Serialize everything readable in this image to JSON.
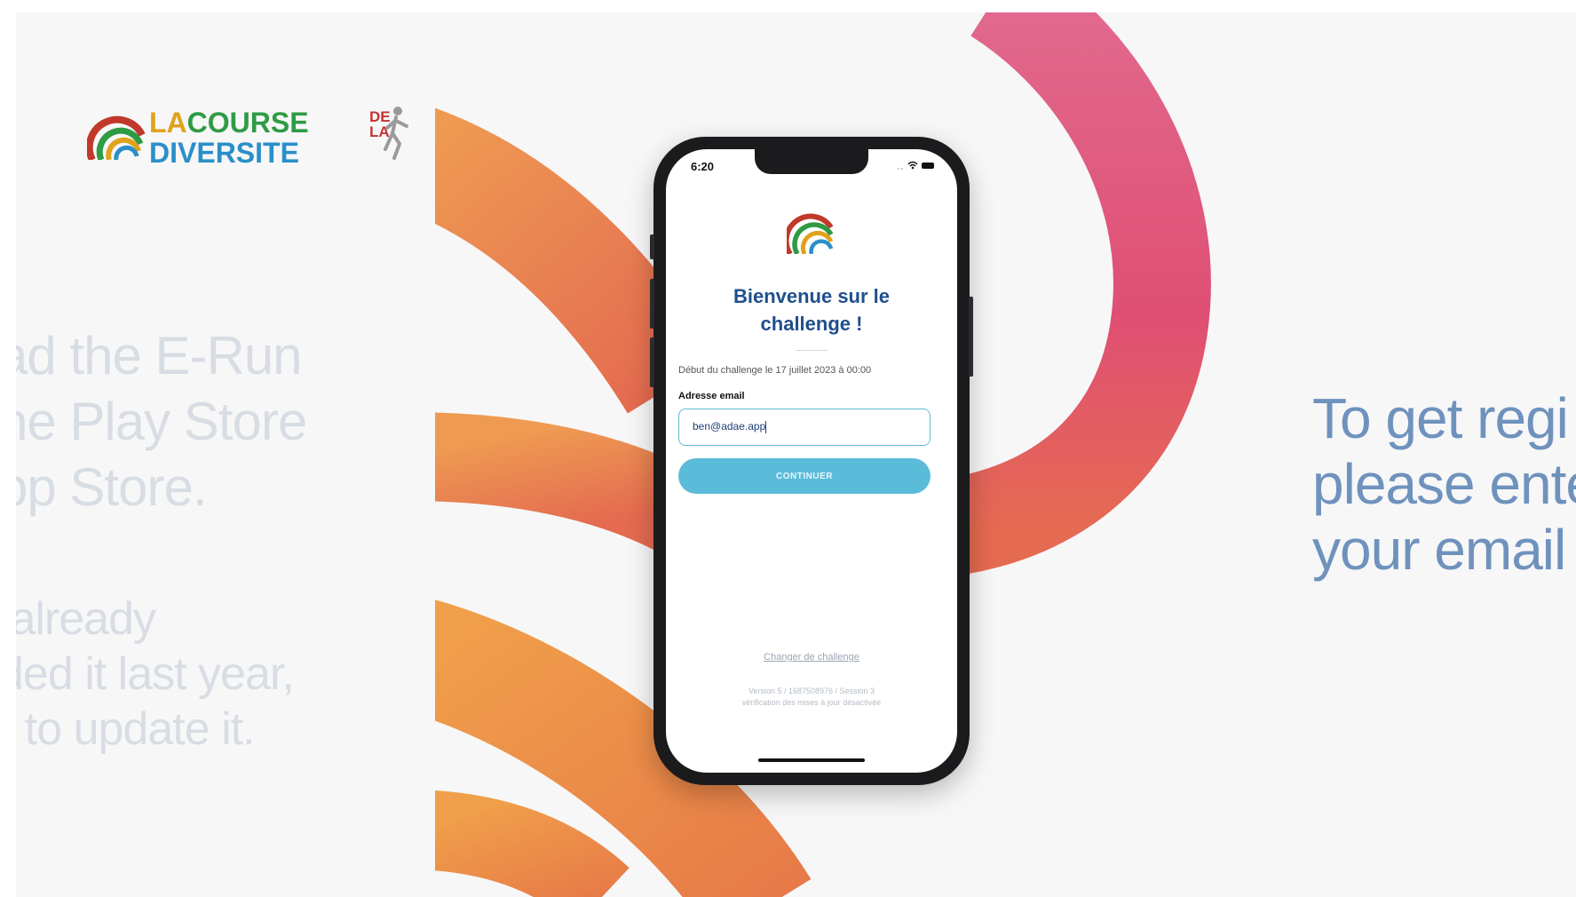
{
  "logo": {
    "line1_la": "LA",
    "line1_course": "COURSE",
    "line2": "DIVERSITE",
    "de_la": "DE LA"
  },
  "left_text": {
    "block1": "ad the E-Run\nhe Play Store\npp Store.",
    "block2": " already\nded it last year,\nr to update it."
  },
  "right_text": "To get regi\nplease ente\nyour email",
  "phone": {
    "status_time": "6:20",
    "welcome_title": "Bienvenue sur le challenge !",
    "start_date": "Début du challenge le 17 juillet 2023 à 00:00",
    "email_label": "Adresse email",
    "email_value": "ben@adae.app",
    "continue_label": "CONTINUER",
    "change_challenge": "Changer de challenge",
    "version_line1": "Version 5 / 1687508976 / Session 3",
    "version_line2": "vérification des mises à jour désactivée"
  },
  "colors": {
    "accent_button": "#5bbcd9",
    "title_blue": "#1f4f8c",
    "right_text_blue": "#6f92bd",
    "swirl_orange": "#e8874e",
    "swirl_pink": "#df4d78"
  }
}
